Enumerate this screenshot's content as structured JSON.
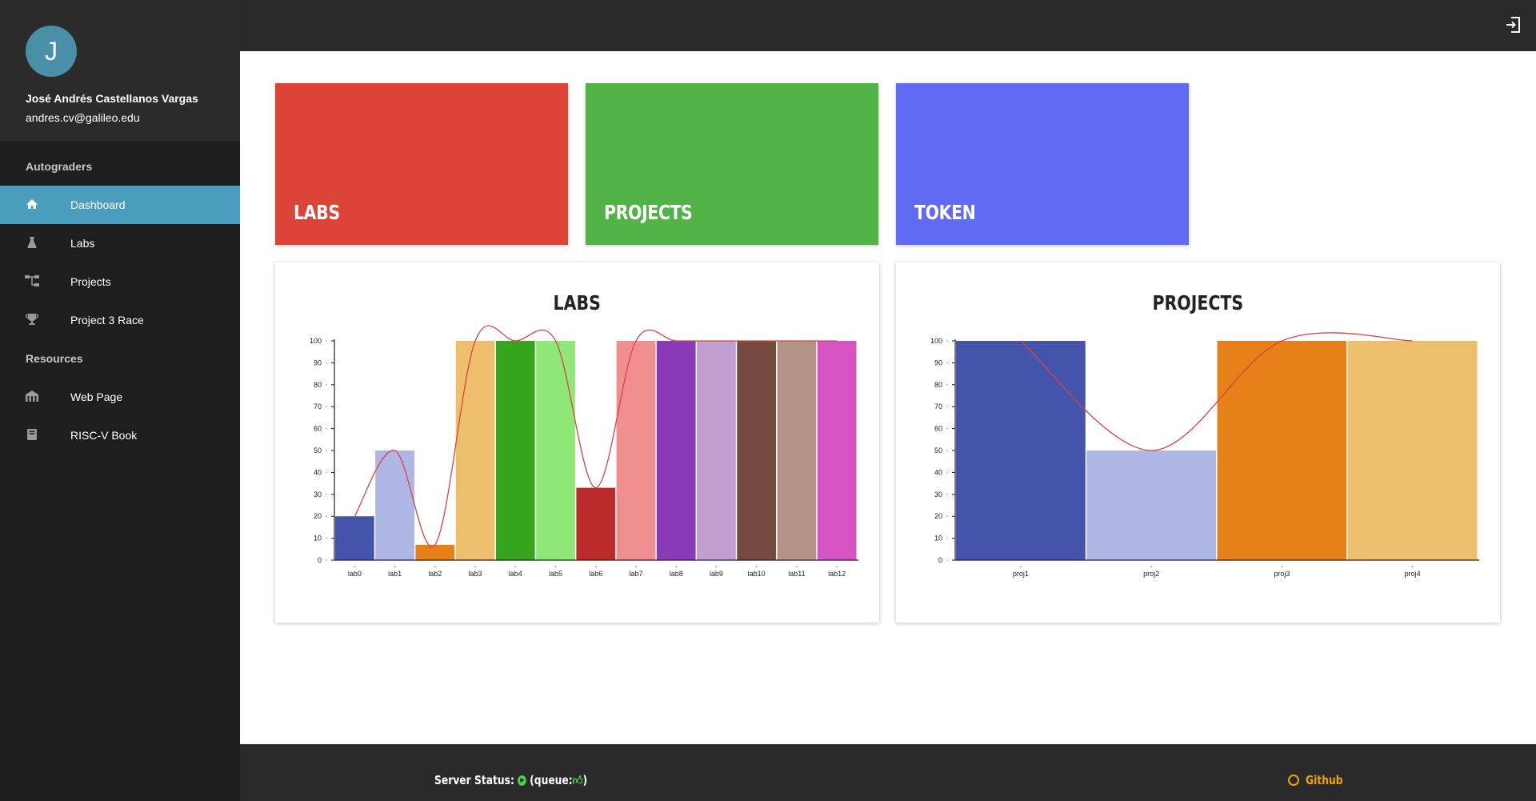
{
  "user": {
    "initial": "J",
    "name": "José Andrés Castellanos Vargas",
    "email": "andres.cv@galileo.edu"
  },
  "sidebar": {
    "sections": [
      {
        "header": "Autograders",
        "items": [
          {
            "label": "Dashboard",
            "icon": "home-icon",
            "active": true
          },
          {
            "label": "Labs",
            "icon": "flask-icon",
            "active": false
          },
          {
            "label": "Projects",
            "icon": "sitemap-icon",
            "active": false
          },
          {
            "label": "Project 3 Race",
            "icon": "trophy-icon",
            "active": false
          }
        ]
      },
      {
        "header": "Resources",
        "items": [
          {
            "label": "Web Page",
            "icon": "building-icon",
            "active": false
          },
          {
            "label": "RISC-V Book",
            "icon": "book-icon",
            "active": false
          }
        ]
      }
    ]
  },
  "topbar": {
    "logout_icon": "logout-icon"
  },
  "tiles": [
    {
      "label": "LABS",
      "color": "#db4437"
    },
    {
      "label": "PROJECTS",
      "color": "#51b345"
    },
    {
      "label": "TOKEN",
      "color": "#606af3"
    }
  ],
  "chart_data": [
    {
      "type": "bar",
      "title": "LABS",
      "categories": [
        "lab0",
        "lab1",
        "lab2",
        "lab3",
        "lab4",
        "lab5",
        "lab6",
        "lab7",
        "lab8",
        "lab9",
        "lab10",
        "lab11",
        "lab12"
      ],
      "values": [
        20,
        50,
        7,
        100,
        100,
        100,
        33,
        100,
        100,
        100,
        100,
        100,
        100
      ],
      "colors": [
        "#4454ab",
        "#aeb6e4",
        "#e6811a",
        "#edbe6b",
        "#37a41e",
        "#8fe777",
        "#bc2b2b",
        "#ef8f8f",
        "#8a3ab7",
        "#c09fd0",
        "#754a3e",
        "#b59488",
        "#d553c2"
      ],
      "overlay": "line",
      "overlay_color": "#e04040",
      "yticks": [
        0,
        10,
        20,
        30,
        40,
        50,
        60,
        70,
        80,
        90,
        100
      ],
      "ylim": [
        0,
        100
      ]
    },
    {
      "type": "bar",
      "title": "PROJECTS",
      "categories": [
        "proj1",
        "proj2",
        "proj3",
        "proj4"
      ],
      "values": [
        100,
        50,
        100,
        100
      ],
      "colors": [
        "#4454ab",
        "#aeb6e4",
        "#e6811a",
        "#edbe6b"
      ],
      "overlay": "line",
      "overlay_color": "#e04040",
      "yticks": [
        0,
        10,
        20,
        30,
        40,
        50,
        60,
        70,
        80,
        90,
        100
      ],
      "ylim": [
        0,
        100
      ]
    }
  ],
  "footer": {
    "status_label": "Server Status:",
    "queue_open": "(queue:",
    "queue_close": ")",
    "github_label": "Github"
  }
}
